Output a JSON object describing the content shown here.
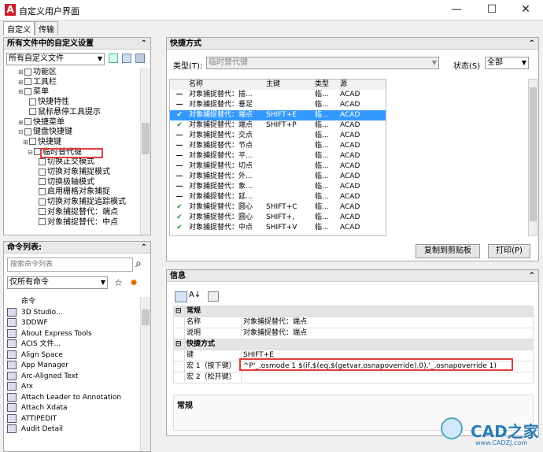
{
  "window": {
    "title": "自定义用户界面",
    "minimize": "—",
    "maximize": "☐",
    "close": "✕"
  },
  "tabs": [
    "自定义",
    "传输"
  ],
  "left_top": {
    "title": "所有文件中的自定义设置",
    "file_select": "所有自定义文件",
    "tree": [
      {
        "label": "功能区",
        "exp": "⊞"
      },
      {
        "label": "工具栏",
        "exp": "⊞"
      },
      {
        "label": "菜单",
        "exp": "⊞"
      },
      {
        "label": "快捷特性",
        "exp": ""
      },
      {
        "label": "鼠标悬停工具提示",
        "exp": ""
      },
      {
        "label": "快捷菜单",
        "exp": "⊞"
      },
      {
        "label": "键盘快捷键",
        "exp": "⊟"
      },
      {
        "label": "快捷键",
        "exp": "⊞"
      },
      {
        "label": "临时替代键",
        "exp": "⊟"
      },
      {
        "label": "切换正交模式",
        "exp": ""
      },
      {
        "label": "切换对象捕捉模式",
        "exp": ""
      },
      {
        "label": "切换极轴模式",
        "exp": ""
      },
      {
        "label": "启用栅格对象捕捉",
        "exp": ""
      },
      {
        "label": "切换对象捕捉追踪模式",
        "exp": ""
      },
      {
        "label": "对象捕捉替代：端点",
        "exp": ""
      },
      {
        "label": "对象捕捉替代：中点",
        "exp": ""
      }
    ]
  },
  "cmd_list": {
    "title": "命令列表:",
    "search_placeholder": "搜索命令列表",
    "filter": "仅所有命令",
    "items": [
      "命令",
      "3D Studio...",
      "3DDWF",
      "About Express Tools",
      "ACIS 文件...",
      "Align Space",
      "App Manager",
      "Arc-Aligned Text",
      "Arx",
      "Attach Leader to Annotation",
      "Attach Xdata",
      "ATTIPEDIT",
      "Audit Detail"
    ]
  },
  "shortcuts": {
    "title": "快捷方式",
    "type_label": "类型(T):",
    "type_value": "临时替代键",
    "status_label": "状态(S)",
    "status_value": "全部",
    "columns": [
      "名称",
      "主键",
      "类型",
      "源"
    ],
    "rows": [
      {
        "mark": "—",
        "name": "对象捕捉替代：插...",
        "key": "",
        "type": "临...",
        "src": "ACAD",
        "sel": false
      },
      {
        "mark": "—",
        "name": "对象捕捉替代：垂足",
        "key": "",
        "type": "临...",
        "src": "ACAD",
        "sel": false
      },
      {
        "mark": "✔",
        "name": "对象捕捉替代：端点",
        "key": "SHIFT+E",
        "type": "临...",
        "src": "ACAD",
        "sel": true
      },
      {
        "mark": "✔",
        "name": "对象捕捉替代：端点",
        "key": "SHIFT+P",
        "type": "临...",
        "src": "ACAD",
        "sel": false
      },
      {
        "mark": "—",
        "name": "对象捕捉替代：交点",
        "key": "",
        "type": "临...",
        "src": "ACAD",
        "sel": false
      },
      {
        "mark": "—",
        "name": "对象捕捉替代：节点",
        "key": "",
        "type": "临...",
        "src": "ACAD",
        "sel": false
      },
      {
        "mark": "—",
        "name": "对象捕捉替代：平...",
        "key": "",
        "type": "临...",
        "src": "ACAD",
        "sel": false
      },
      {
        "mark": "—",
        "name": "对象捕捉替代：切点",
        "key": "",
        "type": "临...",
        "src": "ACAD",
        "sel": false
      },
      {
        "mark": "—",
        "name": "对象捕捉替代：外...",
        "key": "",
        "type": "临...",
        "src": "ACAD",
        "sel": false
      },
      {
        "mark": "—",
        "name": "对象捕捉替代：象...",
        "key": "",
        "type": "临...",
        "src": "ACAD",
        "sel": false
      },
      {
        "mark": "—",
        "name": "对象捕捉替代：延...",
        "key": "",
        "type": "临...",
        "src": "ACAD",
        "sel": false
      },
      {
        "mark": "✔",
        "name": "对象捕捉替代：圆心",
        "key": "SHIFT+C",
        "type": "临...",
        "src": "ACAD",
        "sel": false
      },
      {
        "mark": "✔",
        "name": "对象捕捉替代：圆心",
        "key": "SHIFT+,",
        "type": "临...",
        "src": "ACAD",
        "sel": false
      },
      {
        "mark": "✔",
        "name": "对象捕捉替代：中点",
        "key": "SHIFT+V",
        "type": "临...",
        "src": "ACAD",
        "sel": false
      }
    ],
    "copy_btn": "复制到剪贴板",
    "print_btn": "打印(P)"
  },
  "info": {
    "title": "信息",
    "cat_general": "常规",
    "name_label": "名称",
    "name_value": "对象捕捉替代：端点",
    "desc_label": "说明",
    "desc_value": "对象捕捉替代：端点",
    "cat_shortcut": "快捷方式",
    "key_label": "键",
    "key_value": "SHIFT+E",
    "macro1_label": "宏 1（按下键）",
    "macro1_value": "^P'_.osmode 1 $(if,$(eq,$(getvar,osnapoverride),0),'_.osnapoverride 1)",
    "macro2_label": "宏 2（松开键）",
    "macro2_value": "",
    "footer": "常规"
  },
  "watermark": {
    "main": "CAD之家",
    "sub": "www.CADZJ.com"
  }
}
